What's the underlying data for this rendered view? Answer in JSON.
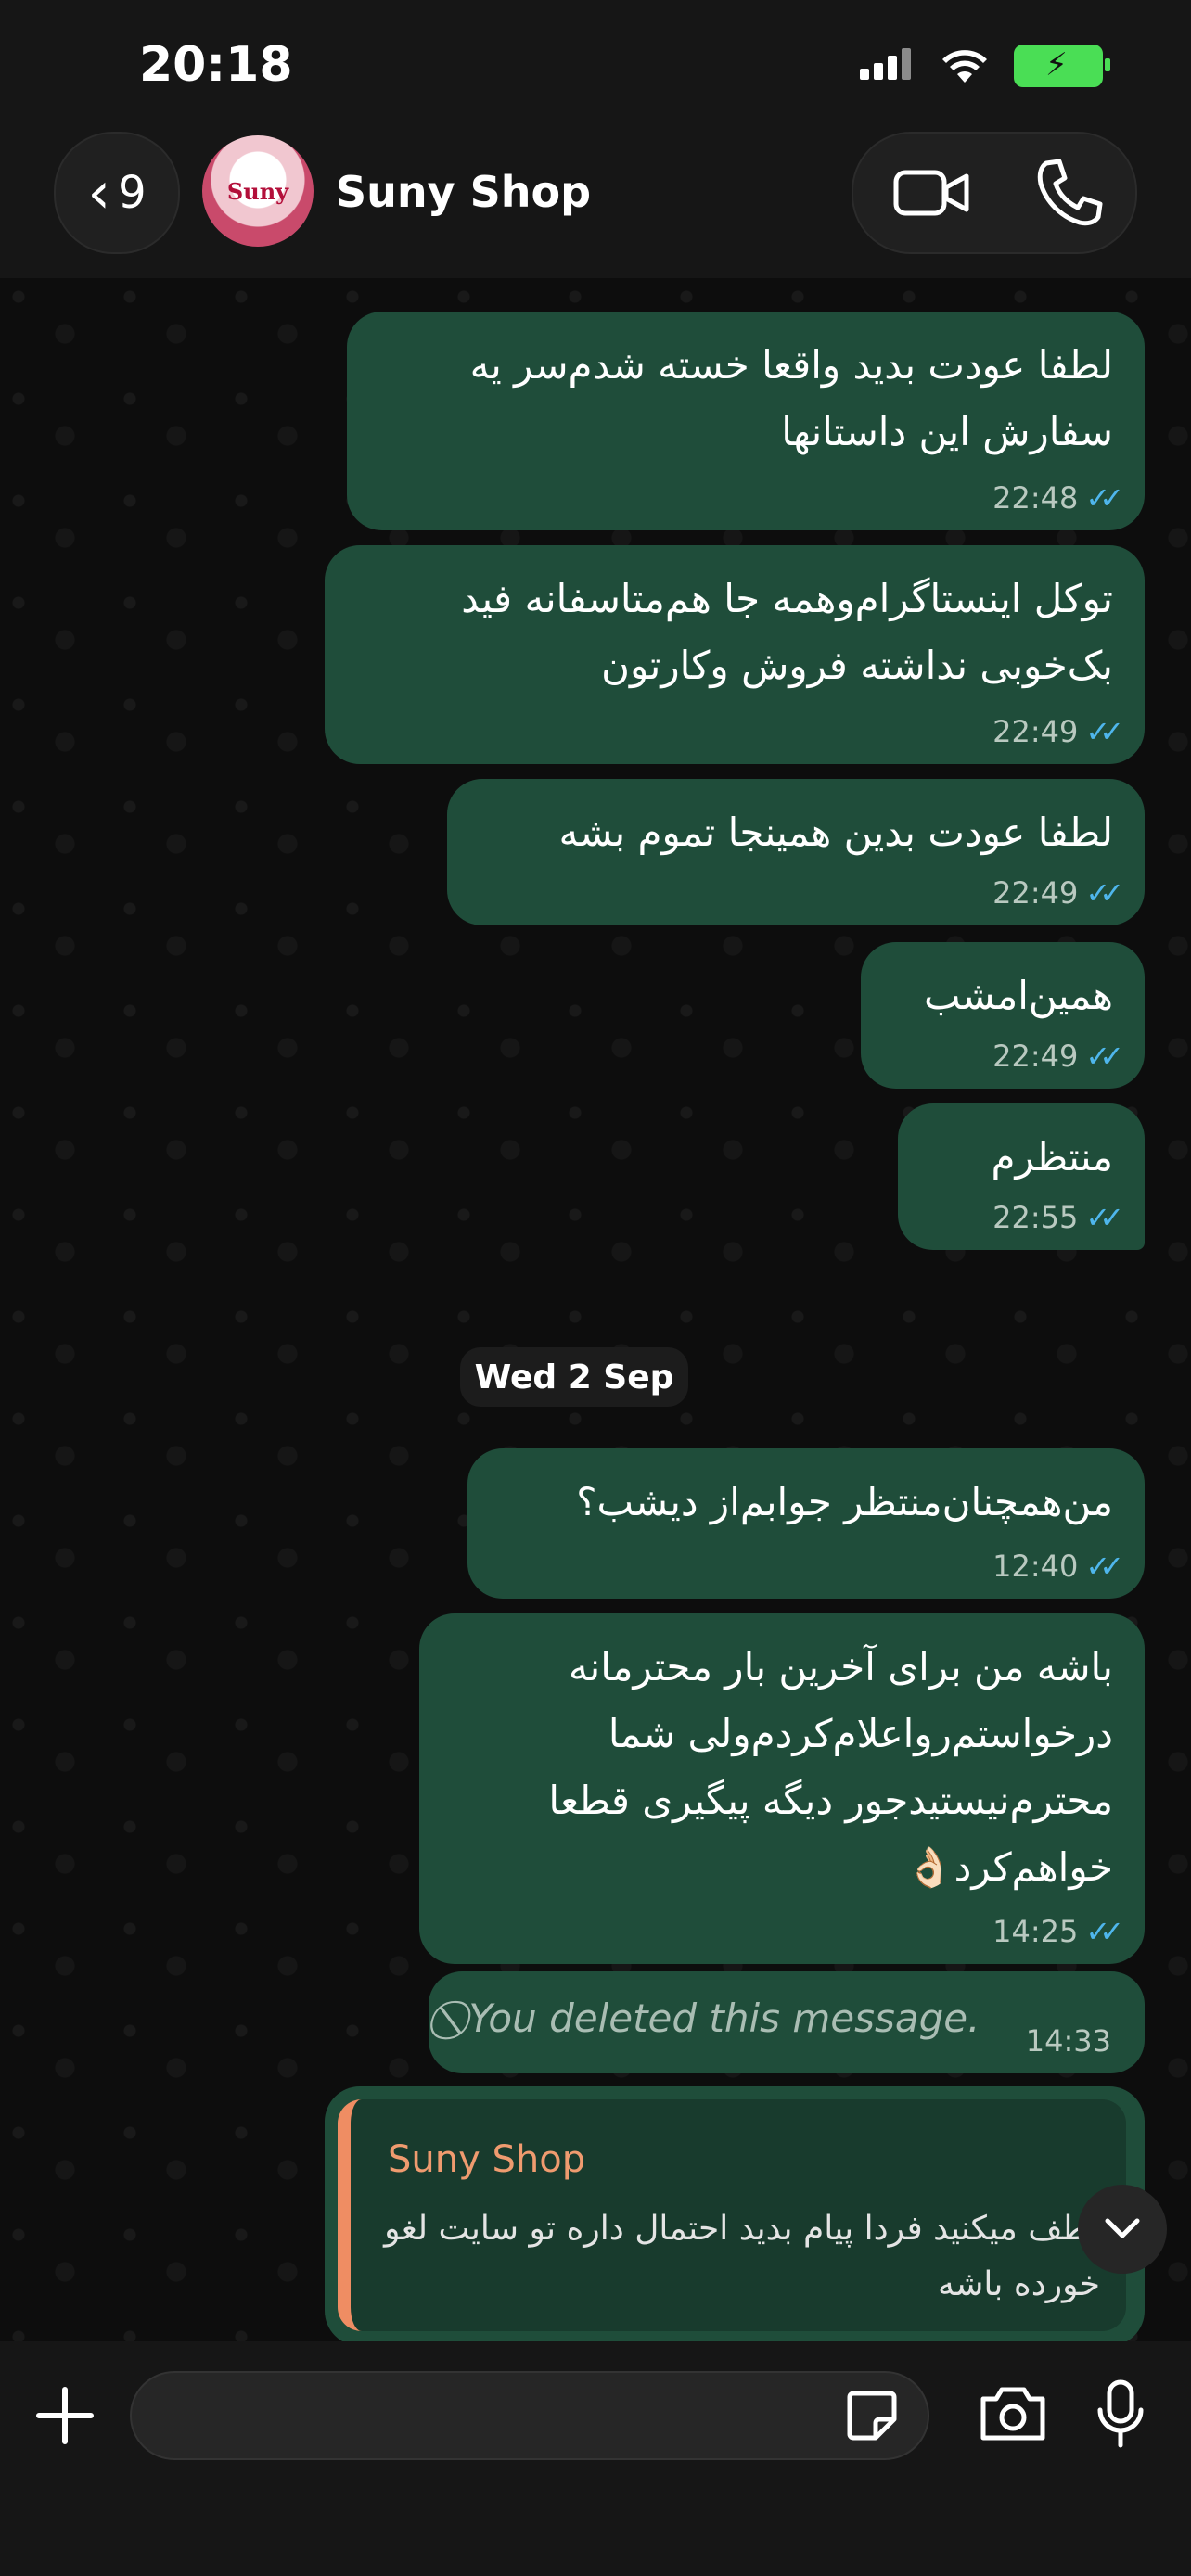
{
  "status_bar": {
    "time": "20:18"
  },
  "header": {
    "back_count": "9",
    "contact_name": "Suny Shop",
    "avatar_text": "Suny"
  },
  "messages": [
    {
      "text": "لطفا عودت بدید واقعا خسته شدم‌سر یه سفارش این داستانها",
      "time": "22:48"
    },
    {
      "text": "توکل اینستاگرام‌وهمه جا هم‌متاسفانه فید بک‌خوبی نداشته فروش وکارتون",
      "time": "22:49"
    },
    {
      "text": "لطفا عودت بدین همینجا تموم بشه",
      "time": "22:49"
    },
    {
      "text": "همین‌امشب",
      "time": "22:49"
    },
    {
      "text": "منتظرم",
      "time": "22:55"
    },
    {
      "text": "من‌همچنان‌منتظر جوابم‌از دیشب؟",
      "time": "12:40"
    },
    {
      "text": "باشه من برای آخرین بار محترمانه درخواستم‌رواعلام‌کردم‌ولی شما محترم‌نیستیدجور دیگه پیگیری قطعا خواهم‌کرد👌🏻",
      "time": "14:25"
    }
  ],
  "date_separator": "Wed 2 Sep",
  "deleted_message": {
    "text": "You deleted this message.",
    "time": "14:33"
  },
  "reply": {
    "name": "Suny Shop",
    "text": "لطف میکنید فردا پیام بدید احتمال داره تو سایت لغو خورده باشه"
  },
  "colors": {
    "bubble": "#1f4d3a",
    "tick": "#4fb6ec",
    "quote_accent": "#ef8d63"
  }
}
